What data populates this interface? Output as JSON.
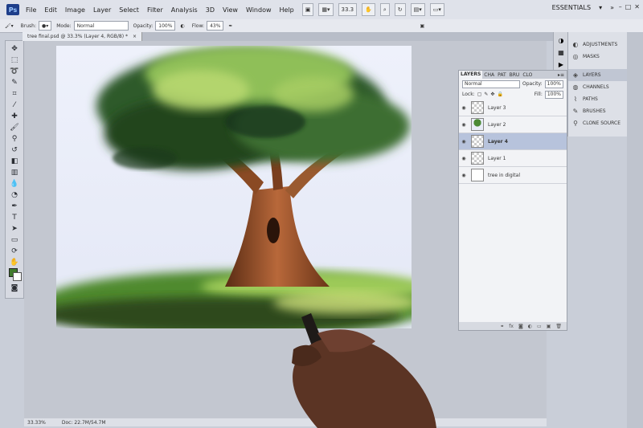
{
  "app": {
    "logo": "Ps",
    "menus": [
      "File",
      "Edit",
      "Image",
      "Layer",
      "Select",
      "Filter",
      "Analysis",
      "3D",
      "View",
      "Window",
      "Help"
    ],
    "zoom_field": "33.3",
    "workspace": "ESSENTIALS"
  },
  "options": {
    "brush_label": "Brush:",
    "mode_label": "Mode:",
    "mode_value": "Normal",
    "opacity_label": "Opacity:",
    "opacity_value": "100%",
    "flow_label": "Flow:",
    "flow_value": "43%"
  },
  "document": {
    "tab_title": "tree final.psd @ 33.3% (Layer 4, RGB/8) *",
    "close": "×"
  },
  "status": {
    "zoom": "33.33%",
    "doc": "Doc: 22.7M/54.7M"
  },
  "layers_panel": {
    "tabs": [
      "LAYERS",
      "CHA",
      "PAT",
      "BRU",
      "CLO"
    ],
    "blend_mode": "Normal",
    "opacity_label": "Opacity:",
    "opacity_value": "100%",
    "lock_label": "Lock:",
    "fill_label": "Fill:",
    "fill_value": "100%",
    "layers": [
      {
        "name": "Layer 3",
        "thumb": "transparent"
      },
      {
        "name": "Layer 2",
        "thumb": "tree"
      },
      {
        "name": "Layer 4",
        "thumb": "transparent",
        "selected": true
      },
      {
        "name": "Layer 1",
        "thumb": "transparent"
      },
      {
        "name": "tree in digital",
        "thumb": "white"
      }
    ]
  },
  "right_panel": {
    "items": [
      {
        "label": "ADJUSTMENTS",
        "icon": "adjustments-icon"
      },
      {
        "label": "MASKS",
        "icon": "masks-icon"
      },
      {
        "label": "LAYERS",
        "icon": "layers-icon",
        "active": true
      },
      {
        "label": "CHANNELS",
        "icon": "channels-icon"
      },
      {
        "label": "PATHS",
        "icon": "paths-icon"
      },
      {
        "label": "BRUSHES",
        "icon": "brushes-icon"
      },
      {
        "label": "CLONE SOURCE",
        "icon": "clone-source-icon"
      }
    ]
  },
  "colors": {
    "foreground": "#3f7a2c",
    "background": "#ffffff",
    "selected_layer": "#b7c3dc"
  }
}
